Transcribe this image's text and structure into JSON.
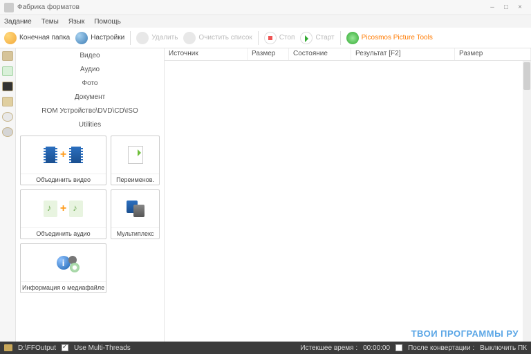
{
  "window": {
    "title": "Фабрика форматов"
  },
  "menu": {
    "task": "Задание",
    "themes": "Темы",
    "lang": "Язык",
    "help": "Помощь"
  },
  "toolbar": {
    "dest_folder": "Конечная папка",
    "settings": "Настройки",
    "delete": "Удалить",
    "clear": "Очистить список",
    "stop": "Стоп",
    "start": "Старт",
    "picosmos": "Picosmos Picture Tools"
  },
  "categories": {
    "video": "Видео",
    "audio": "Аудио",
    "photo": "Фото",
    "document": "Документ",
    "rom": "ROM Устройство\\DVD\\CD\\ISO",
    "utilities": "Utilities"
  },
  "tiles": {
    "join_video": "Объединить видео",
    "rename": "Переименов.",
    "join_audio": "Объединить аудио",
    "mux": "Мультиплекс",
    "mediainfo": "Информация о медиафайле"
  },
  "columns": {
    "source": "Источник",
    "size": "Размер",
    "state": "Состояние",
    "result": "Результат [F2]",
    "size2": "Размер"
  },
  "status": {
    "output_path": "D:\\FFOutput",
    "multithreads": "Use Multi-Threads",
    "elapsed_label": "Истекшее время :",
    "elapsed_value": "00:00:00",
    "after_label": "После конвертации :",
    "after_value": "Выключить ПК"
  },
  "watermark": "ТВОИ ПРОГРАММЫ РУ"
}
